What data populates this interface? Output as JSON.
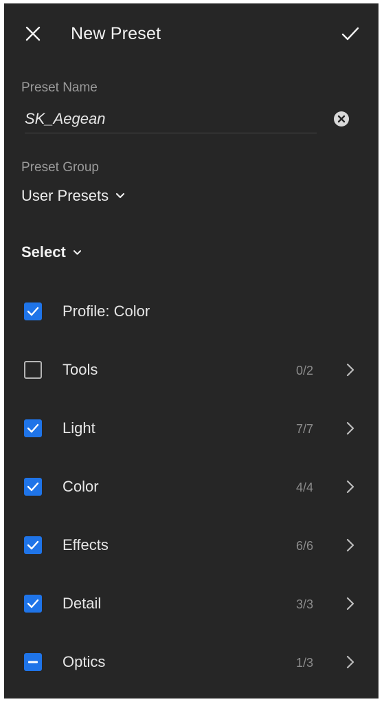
{
  "header": {
    "title": "New Preset",
    "close_icon": "close-icon",
    "confirm_icon": "checkmark-icon"
  },
  "preset_name": {
    "label": "Preset Name",
    "value": "SK_Aegean",
    "clear_icon": "clear-circle-icon"
  },
  "preset_group": {
    "label": "Preset Group",
    "value": "User Presets"
  },
  "select_menu": {
    "label": "Select"
  },
  "settings": [
    {
      "label": "Profile: Color",
      "state": "checked",
      "count": "",
      "has_chevron": false
    },
    {
      "label": "Tools",
      "state": "unchecked",
      "count": "0/2",
      "has_chevron": true
    },
    {
      "label": "Light",
      "state": "checked",
      "count": "7/7",
      "has_chevron": true
    },
    {
      "label": "Color",
      "state": "checked",
      "count": "4/4",
      "has_chevron": true
    },
    {
      "label": "Effects",
      "state": "checked",
      "count": "6/6",
      "has_chevron": true
    },
    {
      "label": "Detail",
      "state": "checked",
      "count": "3/3",
      "has_chevron": true
    },
    {
      "label": "Optics",
      "state": "mixed",
      "count": "1/3",
      "has_chevron": true
    }
  ],
  "colors": {
    "background": "#262626",
    "accent": "#1f74e8",
    "text": "#e6e6e6",
    "muted": "#9a9a9a"
  }
}
